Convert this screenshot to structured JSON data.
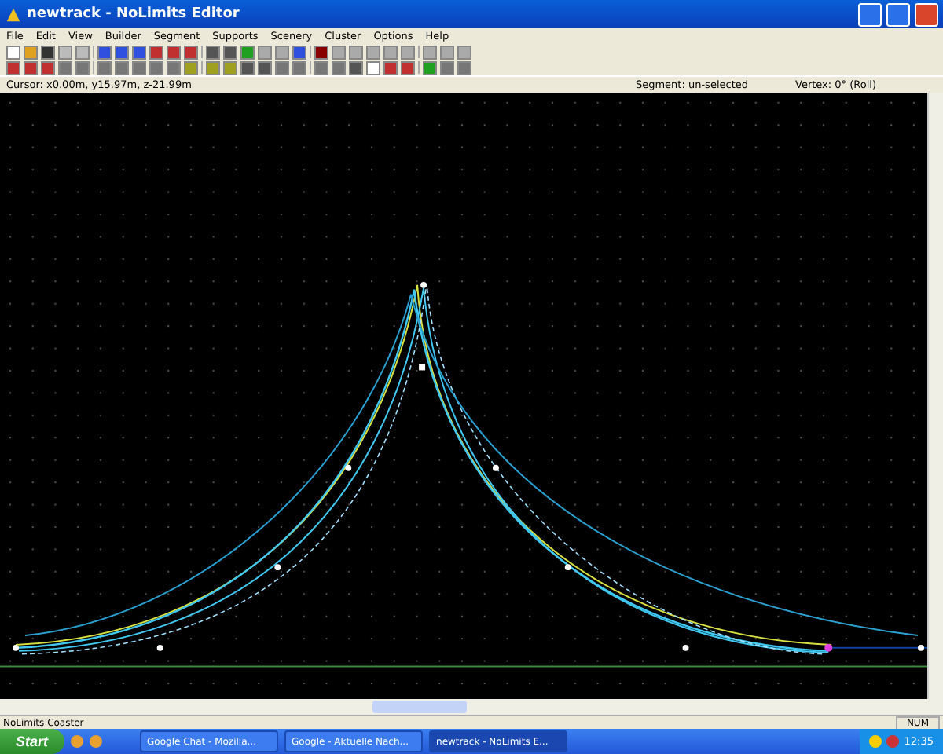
{
  "window": {
    "title": "newtrack - NoLimits Editor"
  },
  "menu": [
    "File",
    "Edit",
    "View",
    "Builder",
    "Segment",
    "Supports",
    "Scenery",
    "Cluster",
    "Options",
    "Help"
  ],
  "info_bar": {
    "cursor": "Cursor: x0.00m, y15.97m, z-21.99m",
    "segment": "Segment: un-selected",
    "vertex": "Vertex: 0° (Roll)"
  },
  "status_bar": {
    "text": "NoLimits Coaster",
    "indicator": "NUM"
  },
  "taskbar": {
    "start": "Start",
    "tasks": [
      {
        "label": "Google Chat - Mozilla...",
        "selected": false
      },
      {
        "label": "Google - Aktuelle Nach...",
        "selected": false
      },
      {
        "label": "newtrack - NoLimits E...",
        "selected": true
      }
    ],
    "clock": "12:35"
  }
}
